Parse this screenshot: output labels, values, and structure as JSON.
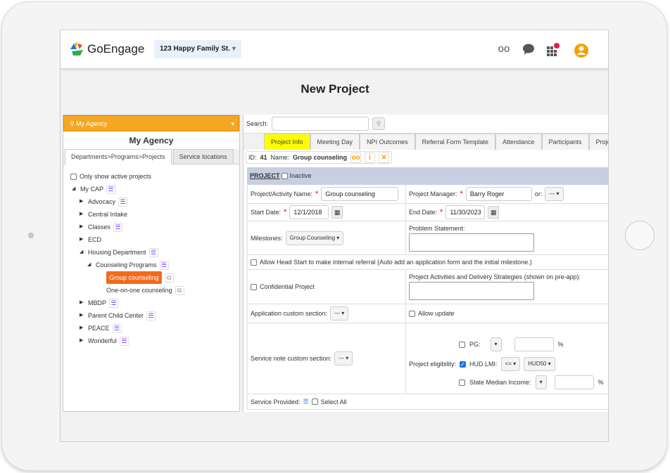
{
  "header": {
    "brand": "GoEngage",
    "location": "123 Happy Family St.",
    "icons": [
      "glasses-icon",
      "chat-icon",
      "apps-grid-icon",
      "user-avatar-icon"
    ],
    "accent": "#f5a623"
  },
  "page_title": "New Project",
  "left": {
    "agency_select": "My Agency",
    "heading": "My Agency",
    "tabs": [
      "Departments>Programs>Projects",
      "Service locations"
    ],
    "only_active": "Only show active projects",
    "tree": [
      {
        "label": "My CAP",
        "level": 0,
        "open": true,
        "icon": true
      },
      {
        "label": "Advocacy",
        "level": 1,
        "icon": true
      },
      {
        "label": "Central Intake",
        "level": 1
      },
      {
        "label": "Classes",
        "level": 1,
        "icon": true
      },
      {
        "label": "ECD",
        "level": 1
      },
      {
        "label": "Housing Department",
        "level": 1,
        "open": true,
        "icon": true
      },
      {
        "label": "Counseling Programs",
        "level": 2,
        "open": true,
        "icon": true
      },
      {
        "label": "Group counseling",
        "level": 3,
        "selected": true
      },
      {
        "label": "One-on-one counseling",
        "level": 3
      },
      {
        "label": "MBDP",
        "level": 1,
        "icon": true
      },
      {
        "label": "Parent Child Center",
        "level": 1,
        "icon": true
      },
      {
        "label": "PEACE",
        "level": 1,
        "icon": true
      },
      {
        "label": "Wonderful",
        "level": 1,
        "icon": true
      }
    ]
  },
  "right": {
    "search_label": "Search:",
    "search_value": "",
    "tabs": [
      "Project Info",
      "Meeting Day",
      "NPI Outcomes",
      "Referral Form Template",
      "Attendance",
      "Participants",
      "Project"
    ],
    "id_label": "ID:",
    "id": "41",
    "name_label": "Name:",
    "name": "Group counseling",
    "section": "PROJECT",
    "inactive": "Inactive",
    "f": {
      "name_label": "Project/Activity Name:",
      "name": "Group counseling",
      "manager_label": "Project Manager:",
      "manager": "Barry Roger",
      "or": "or:",
      "or_value": "--- ▾",
      "start_label": "Start Date:",
      "start": "12/1/2018",
      "end_label": "End Date:",
      "end": "11/30/2023",
      "milestones_label": "Milestones:",
      "milestones": "Group Counseling ▾",
      "problem_label": "Problem Statement:",
      "head_start": "Allow Head Start to make internal referral (Auto add an application form and the initial milestone.)",
      "confidential": "Confidential Project",
      "activities_label": "Project Activities and Delivery Strategies (shown on pre-app):",
      "app_custom_label": "Application custom section:",
      "app_custom": "--- ▾",
      "allow_update": "Allow update",
      "service_note_label": "Service note custom section:",
      "service_note": "--- ▾",
      "eligibility_label": "Project eligibility:",
      "pg": "PG:",
      "pg_op": "▾",
      "pct": "%",
      "hud": "HUD LMI:",
      "hud_op": "<= ▾",
      "hud_val": "HUD50 ▾",
      "smi": "State Median Income:",
      "smi_op": "▾",
      "service_provided": "Service Provided:",
      "select_all": "Select All"
    }
  }
}
